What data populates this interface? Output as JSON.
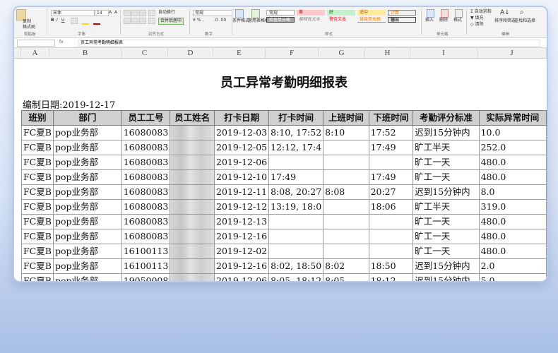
{
  "ribbon": {
    "paste_label": "粘贴",
    "copy_label": "复制",
    "format_painter_label": "格式刷",
    "font_name": "宋体",
    "font_size": "14",
    "wrap_label": "自动换行",
    "merge_label": "合并后居中",
    "number_format": "常规",
    "conditional_format_label": "条件格式",
    "table_format_label": "套用表格格式",
    "styles": {
      "normal": "常规",
      "bad": "差",
      "good": "好",
      "neutral": "适中",
      "calc": "计算",
      "check": "检查单元格",
      "explain": "解释性文本",
      "warning": "警告文本",
      "link": "链接单元格",
      "output": "输出"
    },
    "insert_label": "插入",
    "delete_label": "删除",
    "format_label": "格式",
    "autosum_label": "自动求和",
    "fill_label": "填充",
    "clear_label": "清除",
    "sort_filter_label": "排序和筛选",
    "find_select_label": "查找和选择",
    "groups": {
      "clipboard": "剪贴板",
      "font": "字体",
      "alignment": "对齐方式",
      "number": "数字",
      "styles": "样式",
      "cells": "单元格",
      "editing": "编辑"
    }
  },
  "formula_bar": {
    "name_box": "",
    "fx": "fx",
    "content": "员工异常考勤明细报表"
  },
  "columns": [
    "A",
    "B",
    "C",
    "D",
    "E",
    "F",
    "G",
    "H",
    "I",
    "J"
  ],
  "sheet": {
    "title": "员工异常考勤明细报表",
    "subtitle": "编制日期:2019-12-17",
    "headers": [
      "班别",
      "部门",
      "员工工号",
      "员工姓名",
      "打卡日期",
      "打卡时间",
      "上班时间",
      "下班时间",
      "考勤评分标准",
      "实际异常时间"
    ],
    "rows": [
      [
        "FC夏B",
        "pop业务部",
        "16080083",
        "",
        "2019-12-03",
        "8:10, 17:52",
        "8:10",
        "17:52",
        "迟到15分钟内",
        "10.0"
      ],
      [
        "FC夏B",
        "pop业务部",
        "16080083",
        "",
        "2019-12-05",
        "12:12, 17:4",
        "",
        "17:49",
        "旷工半天",
        "252.0"
      ],
      [
        "FC夏B",
        "pop业务部",
        "16080083",
        "",
        "2019-12-06",
        "",
        "",
        "",
        "旷工一天",
        "480.0"
      ],
      [
        "FC夏B",
        "pop业务部",
        "16080083",
        "",
        "2019-12-10",
        "17:49",
        "",
        "17:49",
        "旷工一天",
        "480.0"
      ],
      [
        "FC夏B",
        "pop业务部",
        "16080083",
        "",
        "2019-12-11",
        "8:08, 20:27",
        "8:08",
        "20:27",
        "迟到15分钟内",
        "8.0"
      ],
      [
        "FC夏B",
        "pop业务部",
        "16080083",
        "",
        "2019-12-12",
        "13:19, 18:0",
        "",
        "18:06",
        "旷工半天",
        "319.0"
      ],
      [
        "FC夏B",
        "pop业务部",
        "16080083",
        "",
        "2019-12-13",
        "",
        "",
        "",
        "旷工一天",
        "480.0"
      ],
      [
        "FC夏B",
        "pop业务部",
        "16080083",
        "",
        "2019-12-16",
        "",
        "",
        "",
        "旷工一天",
        "480.0"
      ],
      [
        "FC夏B",
        "pop业务部",
        "16100113",
        "",
        "2019-12-02",
        "",
        "",
        "",
        "旷工一天",
        "480.0"
      ],
      [
        "FC夏B",
        "pop业务部",
        "16100113",
        "",
        "2019-12-16",
        "8:02, 18:50",
        "8:02",
        "18:50",
        "迟到15分钟内",
        "2.0"
      ],
      [
        "FC夏B",
        "pop业务部",
        "19050008",
        "",
        "2019-12-06",
        "8:05, 18:12",
        "8:05",
        "18:12",
        "迟到15分钟内",
        "5.0"
      ]
    ]
  }
}
